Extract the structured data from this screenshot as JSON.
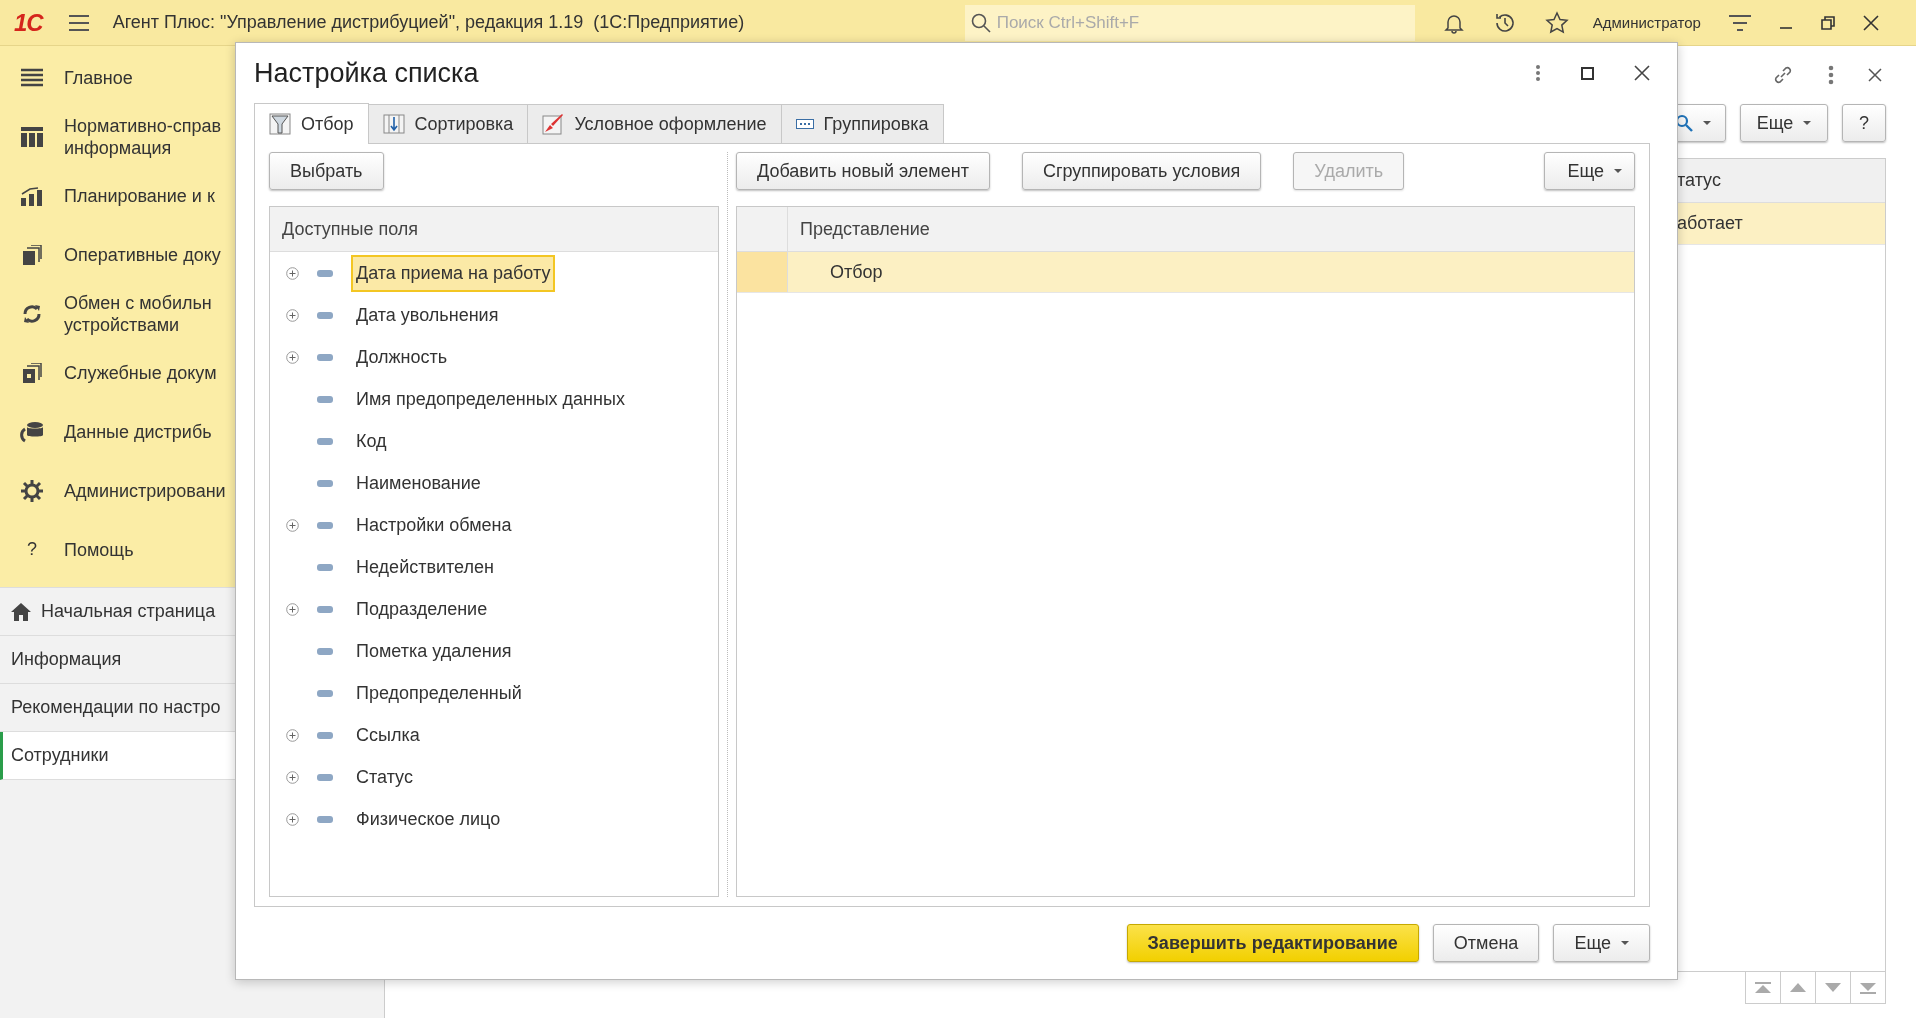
{
  "window": {
    "logo": "1С",
    "title": "Агент Плюс: \"Управление дистрибуцией\", редакция 1.19  (1С:Предприятие)",
    "search": {
      "placeholder": "Поиск Ctrl+Shift+F"
    },
    "user": "Администратор"
  },
  "sidebar": {
    "sections": [
      {
        "label": "Главное",
        "kind": "menu"
      },
      {
        "label": "Нормативно-справ\nинформация",
        "kind": "columns"
      },
      {
        "label": "Планирование и к",
        "kind": "chart"
      },
      {
        "label": "Оперативные доку",
        "kind": "docs"
      },
      {
        "label": "Обмен с мобильн\nустройствами",
        "kind": "sync"
      },
      {
        "label": "Служебные докум",
        "kind": "service"
      },
      {
        "label": "Данные дистрибь",
        "kind": "data"
      },
      {
        "label": "Администрировани",
        "kind": "gear"
      },
      {
        "label": "Помощь",
        "kind": "help",
        "glyph": "?"
      }
    ],
    "open_items": [
      {
        "label": "Начальная страница",
        "kind": "home",
        "selected": false
      },
      {
        "label": "Информация",
        "kind": "form",
        "selected": false
      },
      {
        "label": "Рекомендации по настро",
        "kind": "form",
        "selected": false
      },
      {
        "label": "Сотрудники",
        "kind": "form",
        "selected": true
      }
    ]
  },
  "background_form": {
    "toolbar": [
      "Еще",
      "?"
    ],
    "table": {
      "column": "татус",
      "rows": [
        {
          "cell": "аботает",
          "selected": true
        }
      ]
    }
  },
  "dialog": {
    "title": "Настройка списка",
    "tabs": [
      {
        "label": "Отбор",
        "kind": "filter",
        "selected": true
      },
      {
        "label": "Сортировка",
        "kind": "sort",
        "selected": false
      },
      {
        "label": "Условное оформление",
        "kind": "brush",
        "selected": false
      },
      {
        "label": "Группировка",
        "kind": "group",
        "selected": false
      }
    ],
    "left": {
      "button": "Выбрать",
      "list_header": "Доступные поля",
      "fields": [
        {
          "label": "Дата приема на работу",
          "expandable": true,
          "selected": true
        },
        {
          "label": "Дата увольнения",
          "expandable": true,
          "selected": false
        },
        {
          "label": "Должность",
          "expandable": true,
          "selected": false
        },
        {
          "label": "Имя предопределенных данных",
          "expandable": false,
          "selected": false
        },
        {
          "label": "Код",
          "expandable": false,
          "selected": false
        },
        {
          "label": "Наименование",
          "expandable": false,
          "selected": false
        },
        {
          "label": "Настройки обмена",
          "expandable": true,
          "selected": false
        },
        {
          "label": "Недействителен",
          "expandable": false,
          "selected": false
        },
        {
          "label": "Подразделение",
          "expandable": true,
          "selected": false
        },
        {
          "label": "Пометка удаления",
          "expandable": false,
          "selected": false
        },
        {
          "label": "Предопределенный",
          "expandable": false,
          "selected": false
        },
        {
          "label": "Ссылка",
          "expandable": true,
          "selected": false
        },
        {
          "label": "Статус",
          "expandable": true,
          "selected": false
        },
        {
          "label": "Физическое лицо",
          "expandable": true,
          "selected": false
        }
      ]
    },
    "right": {
      "buttons": [
        {
          "label": "Добавить новый элемент",
          "kind": "normal",
          "disabled": false
        },
        {
          "label": "Сгруппировать условия",
          "kind": "normal",
          "disabled": false
        },
        {
          "label": "Удалить",
          "kind": "normal",
          "disabled": true
        },
        {
          "label": "Еще",
          "kind": "menu",
          "disabled": false
        }
      ],
      "table": {
        "column": "Представление",
        "rows": [
          {
            "label": "Отбор",
            "selected": true
          }
        ]
      }
    },
    "footer": [
      {
        "label": "Завершить редактирование",
        "kind": "default"
      },
      {
        "label": "Отмена",
        "kind": "normal"
      },
      {
        "label": "Еще",
        "kind": "menu"
      }
    ]
  }
}
